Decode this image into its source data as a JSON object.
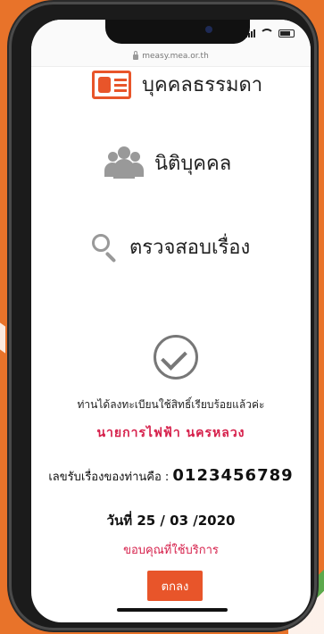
{
  "browser": {
    "url": "measy.mea.or.th"
  },
  "menu": {
    "individual_label": "บุคคลธรรมดา",
    "juristic_label": "นิติบุคคล",
    "check_status_label": "ตรวจสอบเรื่อง"
  },
  "result": {
    "registered_message": "ท่านได้ลงทะเบียนใช้สิทธิ์เรียบร้อยแล้วค่ะ",
    "organization": "นายการไฟฟ้า  นครหลวง",
    "reference_label": "เลขรับเรื่องของท่านคือ : ",
    "reference_number": "0123456789",
    "date": "วันที่ 25 / 03 /2020",
    "thanks": "ขอบคุณที่ใช้บริการ",
    "ok_button_label": "ตกลง"
  },
  "colors": {
    "accent": "#e8552a",
    "highlight_text": "#d6204b",
    "background": "#e8732a"
  },
  "icons": [
    "id-card-icon",
    "group-icon",
    "search-icon",
    "check-circle-icon",
    "lock-icon"
  ]
}
